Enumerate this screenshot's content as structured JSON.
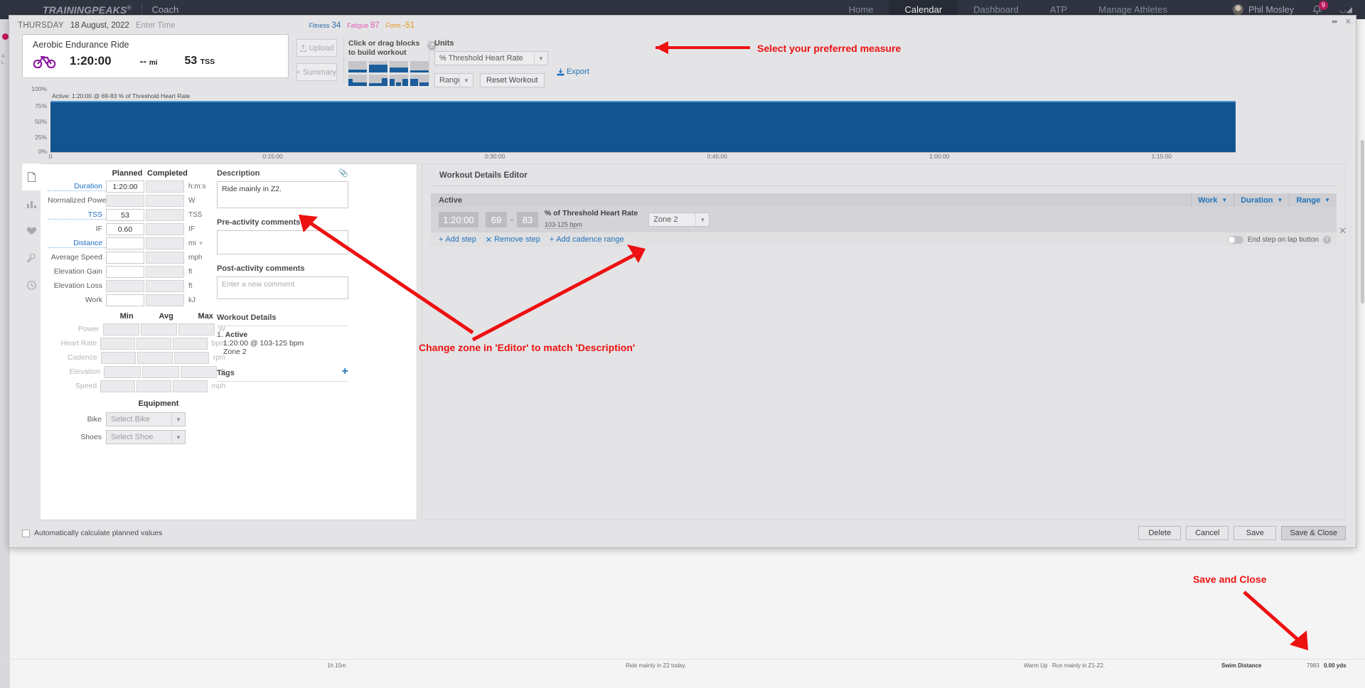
{
  "topnav": {
    "brand": "TRAININGPEAKS",
    "brand_tm": "®",
    "role": "Coach",
    "links": [
      {
        "label": "Home",
        "active": false
      },
      {
        "label": "Calendar",
        "active": true
      },
      {
        "label": "Dashboard",
        "active": false
      },
      {
        "label": "ATP",
        "active": false
      },
      {
        "label": "Manage Athletes",
        "active": false
      }
    ],
    "user_name": "Phil Mosley",
    "notification_count": "9",
    "bell_icon": "bell-icon",
    "expand_icon": "expand-icon",
    "avatar_icon": "avatar"
  },
  "modal": {
    "minimize_icon": "minimize-icon",
    "close_icon": "close-icon"
  },
  "date_row": {
    "day_of_week": "THURSDAY",
    "date": "18 August, 2022",
    "enter_time": "Enter Time",
    "fitness_label": "Fitness",
    "fitness_value": "34",
    "fatigue_label": "Fatigue",
    "fatigue_value": "87",
    "form_label": "Form",
    "form_value": "-51"
  },
  "workout_card": {
    "title": "Aerobic Endurance Ride",
    "sport_icon": "bicycle-icon",
    "duration": "1:20:00",
    "distance": "--",
    "distance_unit": "mi",
    "tss": "53",
    "tss_unit": "TSS"
  },
  "toolbar": {
    "upload_label": "Upload",
    "upload_icon": "upload-icon",
    "summary_label": "Summary",
    "summary_icon": "summary-icon",
    "palette_title_line1": "Click or drag blocks",
    "palette_title_line2": "to build workout",
    "help_icon": "help-icon",
    "units_label": "Units",
    "units_value": "% Threshold Heart Rate",
    "range_value": "Range",
    "reset_label": "Reset Workout",
    "export_label": "Export",
    "export_icon": "export-icon"
  },
  "chart_data": {
    "type": "bar",
    "title": "",
    "tooltip": "Active: 1:20:00 @ 69-83 % of Threshold Heart Rate",
    "ylabel": "",
    "xlabel": "",
    "ylim": [
      0,
      100
    ],
    "yticks": [
      "100%",
      "75%",
      "50%",
      "25%",
      "0%"
    ],
    "ytick_values": [
      100,
      75,
      50,
      25,
      0
    ],
    "xticks": [
      "0",
      "0:15:00",
      "0:30:00",
      "0:45:00",
      "1:00:00",
      "1:15:00"
    ],
    "xtick_positions": [
      0,
      18.75,
      37.5,
      56.25,
      75,
      93.75
    ],
    "grid": false,
    "series": [
      {
        "name": "Active",
        "x_start": 0,
        "x_end": 100,
        "value": 83,
        "color": "#11548f"
      }
    ]
  },
  "rail": {
    "items": [
      {
        "icon": "document-icon",
        "selected": true
      },
      {
        "icon": "chart-icon",
        "selected": false
      },
      {
        "icon": "heart-icon",
        "selected": false
      },
      {
        "icon": "wrench-icon",
        "selected": false
      },
      {
        "icon": "clock-icon",
        "selected": false
      }
    ]
  },
  "stats": {
    "col_planned": "Planned",
    "col_completed": "Completed",
    "rows": [
      {
        "label": "Duration",
        "link": true,
        "planned": "1:20:00",
        "completed": "",
        "unit": "h:m:s",
        "planned_ro": false
      },
      {
        "label": "Normalized Power",
        "link": false,
        "planned": "",
        "completed": "",
        "unit": "W",
        "planned_ro": true
      },
      {
        "label": "TSS",
        "link": true,
        "planned": "53",
        "completed": "",
        "unit": "TSS",
        "planned_ro": false
      },
      {
        "label": "IF",
        "link": false,
        "planned": "0.60",
        "completed": "",
        "unit": "IF",
        "planned_ro": false
      },
      {
        "label": "Distance",
        "link": true,
        "planned": "",
        "completed": "",
        "unit": "mi",
        "planned_ro": false,
        "unit_caret": true
      },
      {
        "label": "Average Speed",
        "link": false,
        "planned": "",
        "completed": "",
        "unit": "mph",
        "planned_ro": false
      },
      {
        "label": "Elevation Gain",
        "link": false,
        "planned": "",
        "completed": "",
        "unit": "ft",
        "planned_ro": false
      },
      {
        "label": "Elevation Loss",
        "link": false,
        "planned": "",
        "completed": "",
        "unit": "ft",
        "planned_ro": true
      },
      {
        "label": "Work",
        "link": false,
        "planned": "",
        "completed": "",
        "unit": "kJ",
        "planned_ro": false
      }
    ],
    "mm_headers": [
      "Min",
      "Avg",
      "Max"
    ],
    "mm_rows": [
      {
        "label": "Power",
        "unit": "W"
      },
      {
        "label": "Heart Rate",
        "unit": "bpm"
      },
      {
        "label": "Cadence",
        "unit": "rpm"
      },
      {
        "label": "Elevation",
        "unit": "ft"
      },
      {
        "label": "Speed",
        "unit": "mph"
      }
    ],
    "equipment_title": "Equipment",
    "bike_label": "Bike",
    "bike_value": "Select Bike",
    "shoes_label": "Shoes",
    "shoes_value": "Select Shoe"
  },
  "description": {
    "title": "Description",
    "clip_icon": "paperclip-icon",
    "text": "Ride mainly in Z2.",
    "pre_title": "Pre-activity comments",
    "pre_text": "",
    "post_title": "Post-activity comments",
    "post_placeholder": "Enter a new comment",
    "details_title": "Workout Details",
    "details_step_num": "1.",
    "details_step_name": "Active",
    "details_line1": "1:20:00 @ 103-125 bpm",
    "details_line2": "Zone 2",
    "tags_title": "Tags",
    "tags_add_icon": "plus-icon"
  },
  "editor": {
    "title": "Workout Details Editor",
    "interval_name": "Active",
    "header_controls": [
      {
        "label": "Work",
        "caret": true
      },
      {
        "label": "Duration",
        "caret": true
      },
      {
        "label": "Range",
        "caret": true
      }
    ],
    "duration": "1:20:00",
    "low": "69",
    "high": "83",
    "dash": "-",
    "unit_title": "% of Threshold Heart Rate",
    "unit_sub": "103-125 bpm",
    "zone_value": "Zone 2",
    "add_step": "Add step",
    "remove_step": "Remove step",
    "add_cadence": "Add cadence range",
    "lap_toggle_label": "End step on lap button",
    "lap_help_icon": "help-icon",
    "close_icon": "close-icon"
  },
  "footer": {
    "auto_calc_label": "Automatically calculate planned values",
    "delete": "Delete",
    "cancel": "Cancel",
    "save": "Save",
    "save_close": "Save & Close"
  },
  "annotations": [
    {
      "text": "Select your preferred measure"
    },
    {
      "text": "Change zone in 'Editor' to match 'Description'"
    },
    {
      "text": "Save and Close"
    }
  ],
  "background_calendar": {
    "strip_items": [
      "1h 15m",
      "Ride mainly in Z2 today.",
      "Warm Up",
      "Run mainly in Z1-Z2.",
      "Swim Distance",
      "7983",
      "0.00 yds"
    ]
  }
}
